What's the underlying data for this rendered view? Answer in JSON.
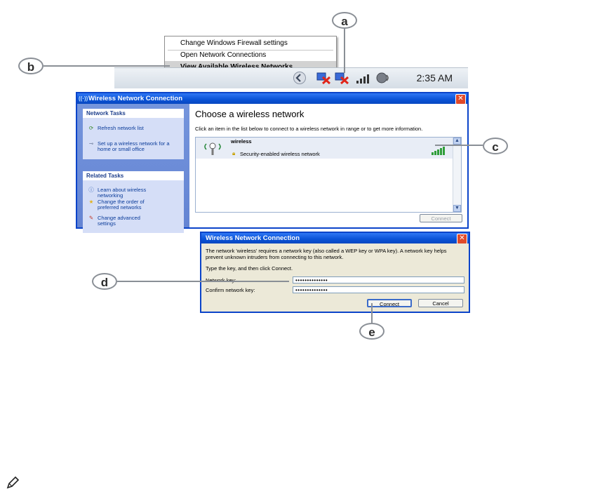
{
  "callouts": {
    "a": "a",
    "b": "b",
    "c": "c",
    "d": "d",
    "e": "e"
  },
  "context_menu": {
    "items": [
      "Change Windows Firewall settings",
      "Open Network Connections",
      "View Available Wireless Networks"
    ]
  },
  "taskbar": {
    "clock": "2:35 AM"
  },
  "wireless_window": {
    "title": "Wireless Network Connection",
    "network_tasks": {
      "header": "Network Tasks",
      "items": [
        "Refresh network list",
        "Set up a wireless network for a home or small office"
      ]
    },
    "related_tasks": {
      "header": "Related Tasks",
      "items": [
        "Learn about wireless networking",
        "Change the order of preferred networks",
        "Change advanced settings"
      ]
    },
    "heading": "Choose a wireless network",
    "instruction": "Click an item in the list below to connect to a wireless network in range or to get more information.",
    "network": {
      "name": "wireless",
      "security": "Security-enabled wireless network"
    },
    "connect_label": "Connect"
  },
  "key_dialog": {
    "title": "Wireless Network Connection",
    "message": "The network 'wireless' requires a network key (also called a WEP key or WPA key). A network key helps prevent unknown intruders from connecting to this network.",
    "prompt": "Type the key, and then click Connect.",
    "network_key_label": "Network key:",
    "network_key_value": "••••••••••••••",
    "confirm_key_label": "Confirm network key:",
    "confirm_key_value": "••••••••••••••",
    "connect_label": "Connect",
    "cancel_label": "Cancel"
  },
  "icons": [
    "pencil-note-icon",
    "close-icon",
    "refresh-icon",
    "wireless-setup-icon",
    "help-icon",
    "star-icon",
    "settings-icon",
    "antenna-icon",
    "lock-icon",
    "signal-bars-icon"
  ]
}
